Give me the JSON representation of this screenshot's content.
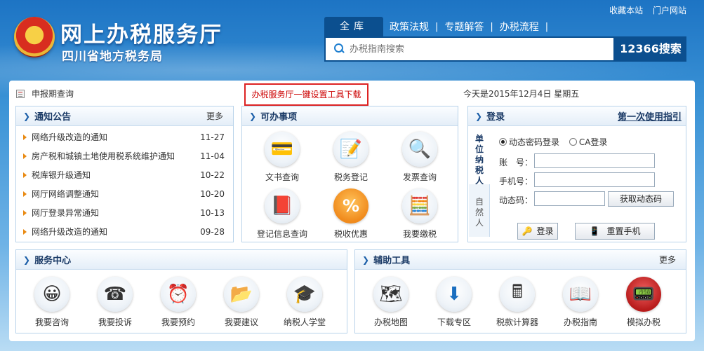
{
  "toplinks": [
    "收藏本站",
    "门户网站"
  ],
  "logo": {
    "title": "网上办税服务厅",
    "subtitle": "四川省地方税务局"
  },
  "search": {
    "tabs": [
      "全库",
      "政策法规",
      "专题解答",
      "办税流程"
    ],
    "placeholder": "办税指南搜索",
    "button": "12366搜索"
  },
  "bar": {
    "query": "申报期查询",
    "download": "办税服务厅一键设置工具下载",
    "date": "今天是2015年12月4日 星期五"
  },
  "notice": {
    "title": "通知公告",
    "more": "更多",
    "items": [
      {
        "text": "网络升级改造的通知",
        "date": "11-27"
      },
      {
        "text": "房产税和城镇土地使用税系统维护通知",
        "date": "11-04"
      },
      {
        "text": "税库银升级通知",
        "date": "10-22"
      },
      {
        "text": "网厅网络调整通知",
        "date": "10-20"
      },
      {
        "text": "网厅登录异常通知",
        "date": "10-13"
      },
      {
        "text": "网络升级改造的通知",
        "date": "09-28"
      }
    ]
  },
  "todo": {
    "title": "可办事项",
    "items": [
      {
        "label": "文书查询",
        "icon": "card-icon"
      },
      {
        "label": "税务登记",
        "icon": "form-icon"
      },
      {
        "label": "发票查询",
        "icon": "magnifier-icon"
      },
      {
        "label": "登记信息查询",
        "icon": "book-icon"
      },
      {
        "label": "税收优惠",
        "icon": "percent-icon"
      },
      {
        "label": "我要缴税",
        "icon": "coins-icon"
      }
    ]
  },
  "login": {
    "title": "登录",
    "guide": "第一次使用指引",
    "tab_unit": "单位纳税人",
    "tab_person": "自然人",
    "opt_dynamic": "动态密码登录",
    "opt_ca": "CA登录",
    "account_label": "账　号：",
    "phone_label": "手机号：",
    "code_label": "动态码：",
    "get_code": "获取动态码",
    "login_btn": "登录",
    "reset_btn": "重置手机"
  },
  "service": {
    "title": "服务中心",
    "items": [
      {
        "label": "我要咨询",
        "icon": "chat-icon"
      },
      {
        "label": "我要投诉",
        "icon": "phone-icon"
      },
      {
        "label": "我要预约",
        "icon": "clock-icon"
      },
      {
        "label": "我要建议",
        "icon": "folder-icon"
      },
      {
        "label": "纳税人学堂",
        "icon": "graduation-cap-icon"
      }
    ]
  },
  "tools": {
    "title": "辅助工具",
    "more": "更多",
    "items": [
      {
        "label": "办税地图",
        "icon": "map-icon"
      },
      {
        "label": "下载专区",
        "icon": "download-icon"
      },
      {
        "label": "税款计算器",
        "icon": "calculator-icon"
      },
      {
        "label": "办税指南",
        "icon": "guide-icon"
      },
      {
        "label": "模拟办税",
        "icon": "simulate-icon"
      }
    ]
  }
}
